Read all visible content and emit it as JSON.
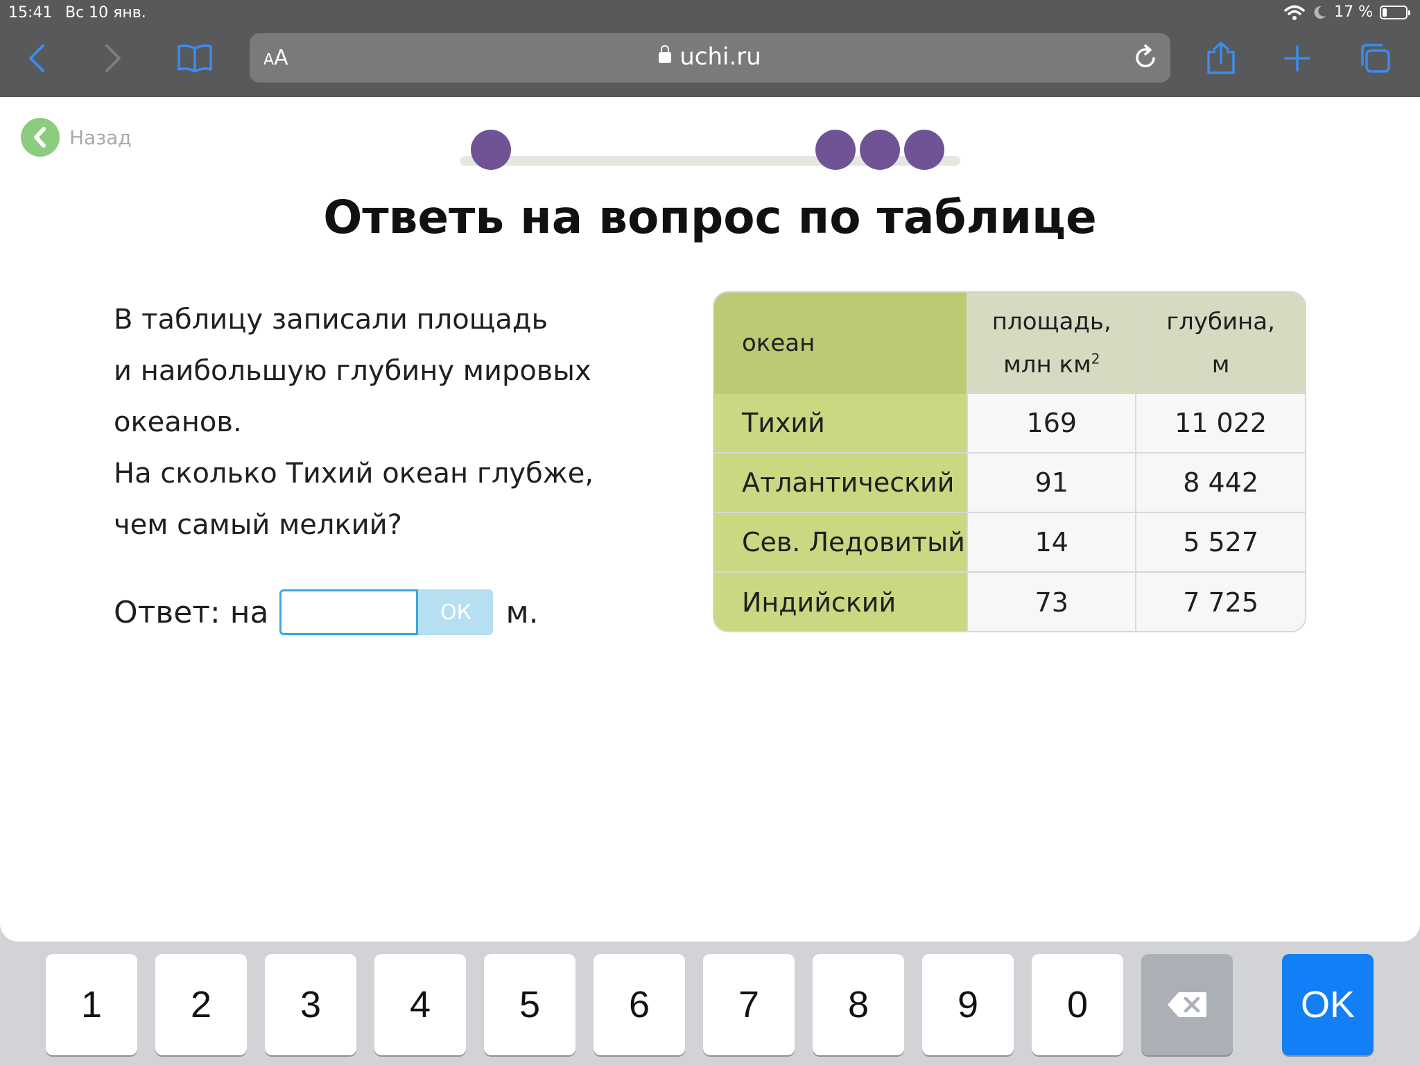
{
  "status_bar": {
    "time": "15:41",
    "date": "Вс 10 янв.",
    "battery": "17 %"
  },
  "browser": {
    "text_size_label_small": "A",
    "text_size_label": "A",
    "url": "uchi.ru"
  },
  "page": {
    "back_label": "Назад",
    "title": "Ответь на вопрос по таблице",
    "question_lines": [
      "В таблицу записали площадь",
      "и наибольшую глубину мировых",
      "океанов.",
      "На сколько Тихий океан глубже,",
      "чем самый мелкий?"
    ],
    "answer": {
      "prefix": "Ответ: на",
      "value": "",
      "ok_label": "ОК",
      "unit": "м."
    },
    "progress": {
      "total": 4,
      "completed": 4
    }
  },
  "table": {
    "headers": {
      "ocean": "океан",
      "area_line1": "площадь,",
      "area_line2": "млн км",
      "area_sup": "2",
      "depth_line1": "глубина,",
      "depth_line2": "м"
    },
    "rows": [
      {
        "ocean": "Тихий",
        "area": "169",
        "depth": "11 022"
      },
      {
        "ocean": "Атлантический",
        "area": "91",
        "depth": "8 442"
      },
      {
        "ocean": "Сев. Ледовитый",
        "area": "14",
        "depth": "5 527"
      },
      {
        "ocean": "Индийский",
        "area": "73",
        "depth": "7 725"
      }
    ]
  },
  "keyboard": {
    "keys": [
      "1",
      "2",
      "3",
      "4",
      "5",
      "6",
      "7",
      "8",
      "9",
      "0"
    ],
    "ok_label": "OK"
  },
  "colors": {
    "accent_purple": "#6f5394",
    "back_green": "#8ccc7f",
    "input_border": "#3aa7e3",
    "keyboard_ok": "#137ff6",
    "toolbar_icon": "#3b8cf0"
  }
}
